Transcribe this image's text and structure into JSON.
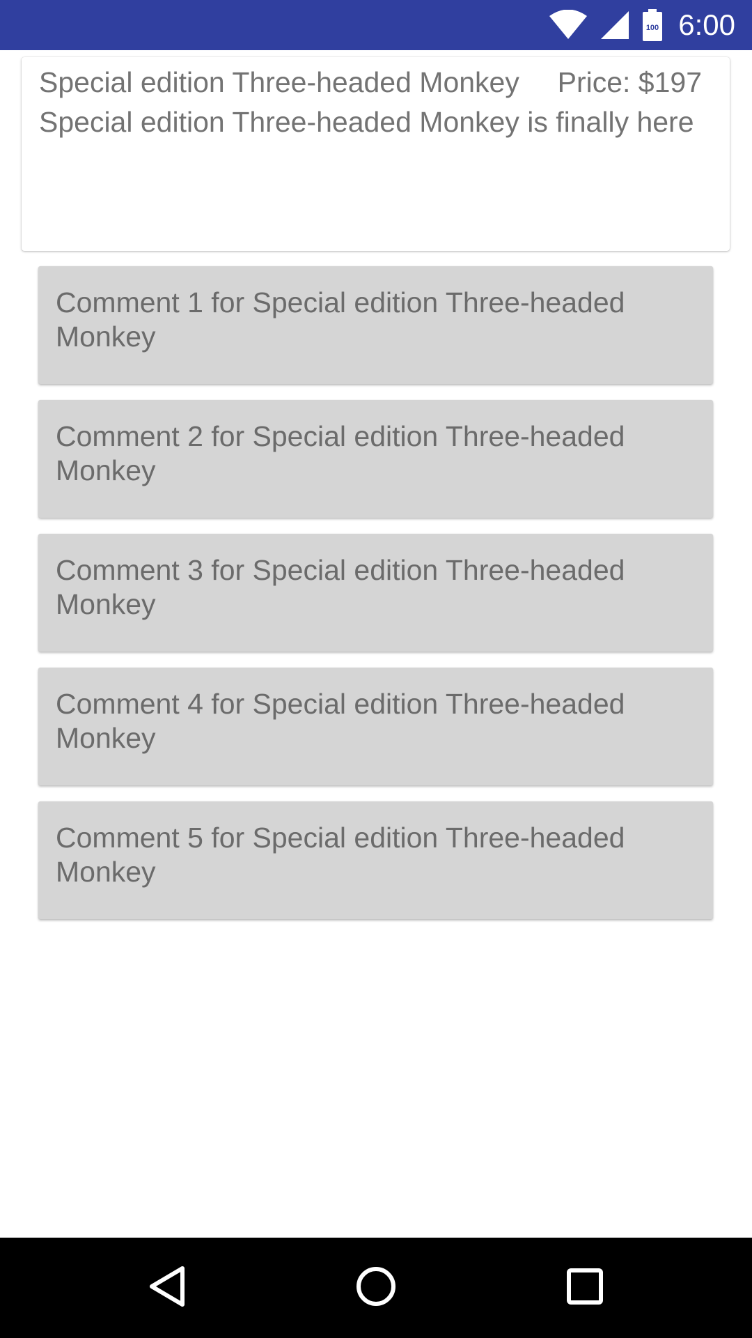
{
  "status_bar": {
    "time": "6:00",
    "battery_level": "100",
    "background_color": "#303F9F",
    "icons": [
      "wifi-icon",
      "signal-icon",
      "battery-icon"
    ]
  },
  "product": {
    "name": "Special edition Three-headed Monkey",
    "price": "Price: $197",
    "description": "Special edition Three-headed Monkey is finally here"
  },
  "comments": [
    {
      "text": "Comment 1 for Special edition Three-headed Monkey"
    },
    {
      "text": "Comment 2 for Special edition Three-headed Monkey"
    },
    {
      "text": "Comment 3 for Special edition Three-headed Monkey"
    },
    {
      "text": "Comment 4 for Special edition Three-headed Monkey"
    },
    {
      "text": "Comment 5 for Special edition Three-headed Monkey"
    }
  ],
  "nav_bar": {
    "buttons": [
      "back-icon",
      "home-icon",
      "recents-icon"
    ]
  }
}
